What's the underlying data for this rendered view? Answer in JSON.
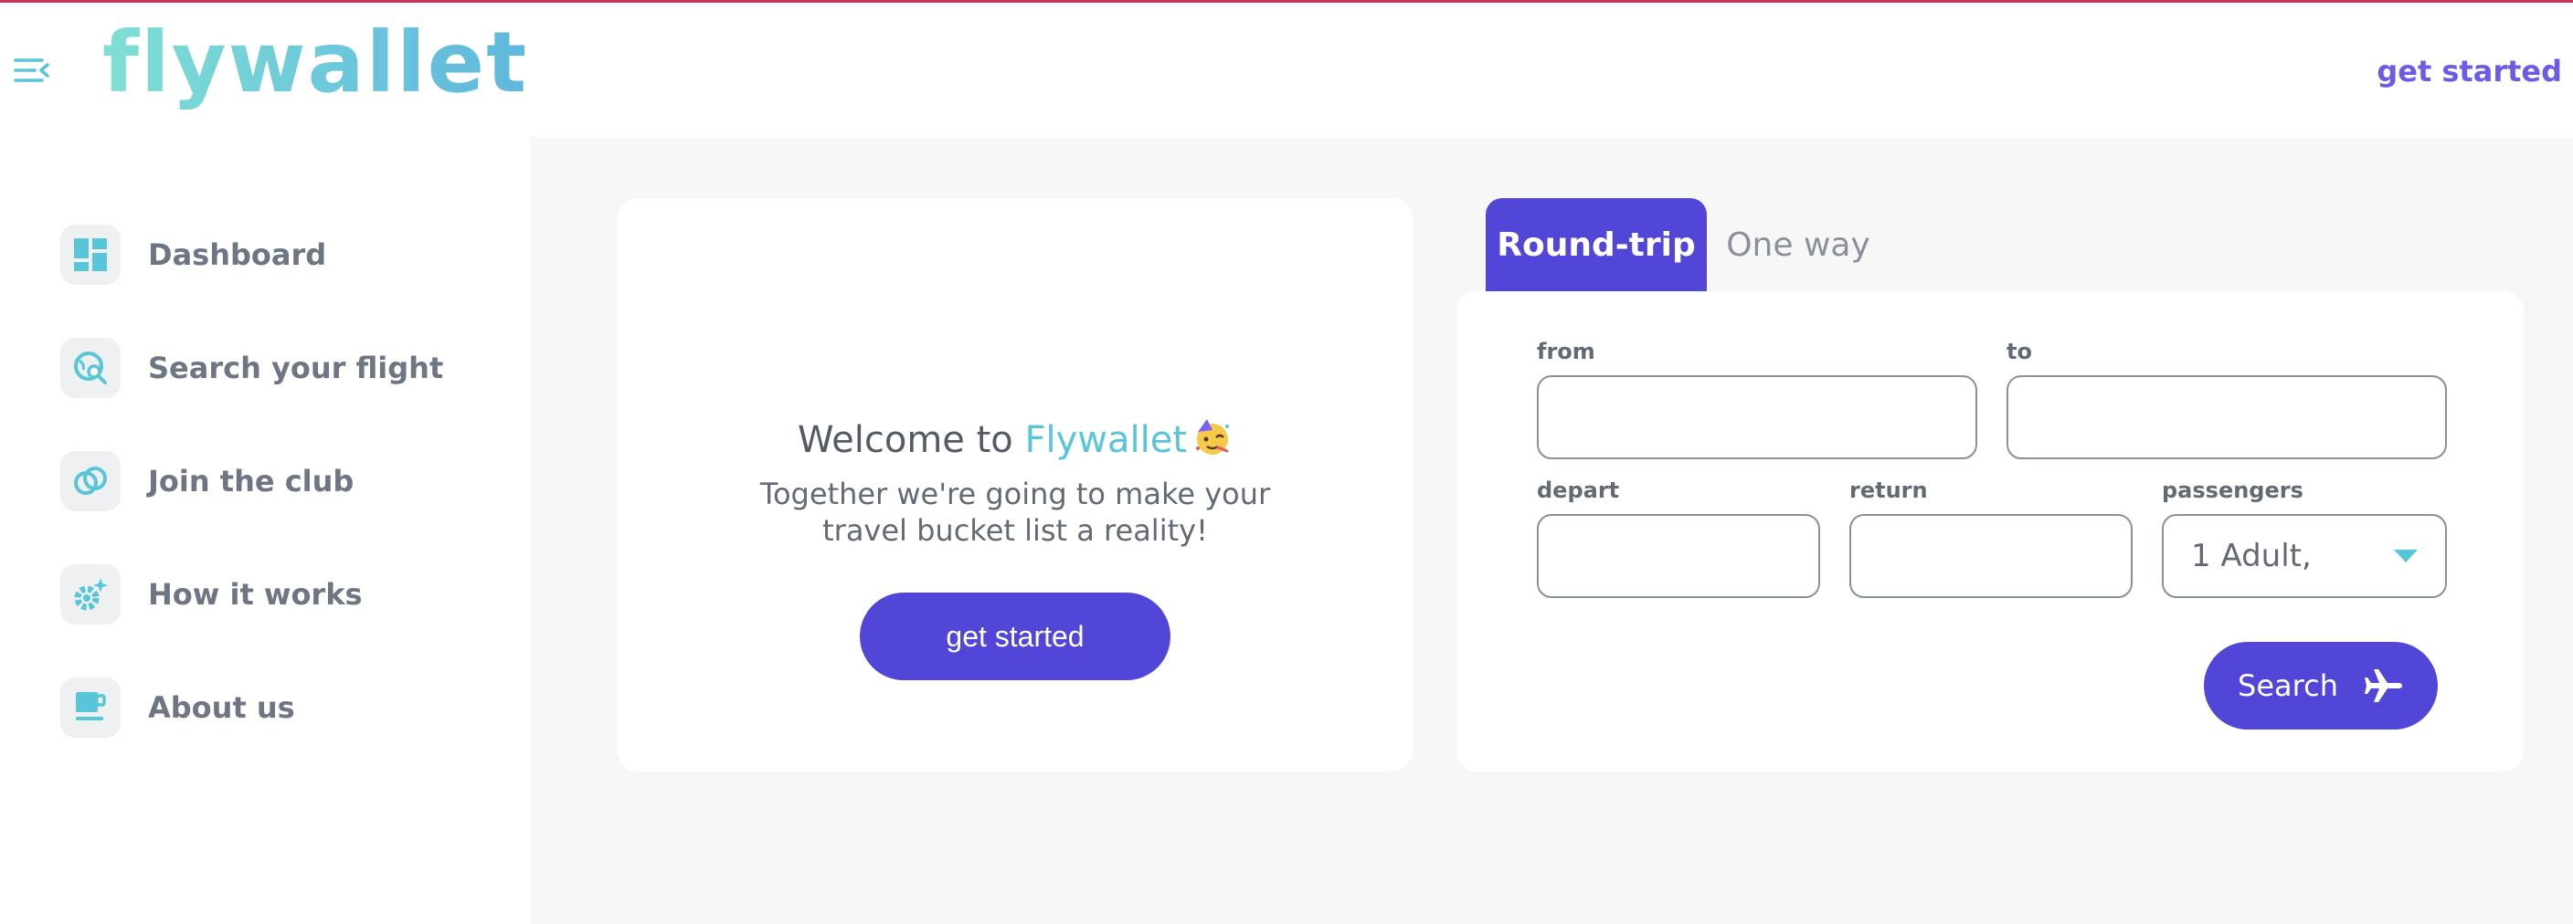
{
  "header": {
    "logo_text": "flywallet",
    "cta_label": "get started"
  },
  "sidebar": {
    "items": [
      {
        "label": "Dashboard",
        "icon": "dashboard-icon"
      },
      {
        "label": "Search your flight",
        "icon": "search-globe-icon"
      },
      {
        "label": "Join the club",
        "icon": "rings-icon"
      },
      {
        "label": "How it works",
        "icon": "gears-icon"
      },
      {
        "label": "About us",
        "icon": "coffee-cup-icon"
      }
    ]
  },
  "welcome": {
    "title_prefix": "Welcome to ",
    "title_brand": "Flywallet",
    "subtitle": "Together we're going to make your travel bucket list a reality!",
    "button_label": "get started"
  },
  "search": {
    "tabs": [
      {
        "label": "Round-trip",
        "active": true
      },
      {
        "label": "One way",
        "active": false
      }
    ],
    "from_label": "from",
    "to_label": "to",
    "depart_label": "depart",
    "return_label": "return",
    "passengers_label": "passengers",
    "passengers_value": "1 Adult,",
    "button_label": "Search"
  },
  "colors": {
    "primary": "#5146d8",
    "accent": "#58c6d8",
    "header_link": "#6b5ce7",
    "text": "#6f7683",
    "background": "#f7f7f8"
  }
}
